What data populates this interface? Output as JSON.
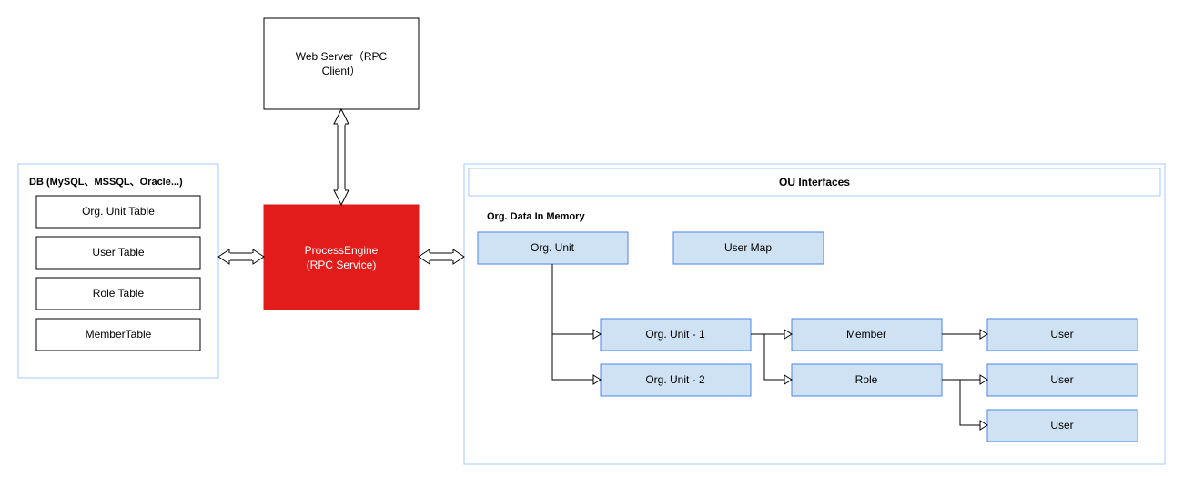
{
  "web_server": {
    "label1": "Web Server（RPC",
    "label2": "Client）"
  },
  "process_engine": {
    "label1": "ProcessEngine",
    "label2": "(RPC Service)"
  },
  "db_panel": {
    "title": "DB (MySQL、MSSQL、Oracle...)",
    "tables": [
      "Org. Unit Table",
      "User Table",
      "Role Table",
      "MemberTable"
    ]
  },
  "ou_panel": {
    "title": "OU Interfaces",
    "subtitle": "Org. Data In Memory",
    "root": "Org. Unit",
    "user_map": "User Map",
    "children": [
      "Org. Unit - 1",
      "Org. Unit - 2"
    ],
    "members": [
      "Member",
      "Role"
    ],
    "users": [
      "User",
      "User",
      "User"
    ]
  },
  "chart_data": {
    "type": "diagram",
    "nodes": [
      {
        "id": "web_server",
        "label": "Web Server (RPC Client)"
      },
      {
        "id": "process_engine",
        "label": "ProcessEngine (RPC Service)",
        "highlight": true
      },
      {
        "id": "db",
        "label": "DB (MySQL, MSSQL, Oracle...)",
        "children": [
          "Org. Unit Table",
          "User Table",
          "Role Table",
          "MemberTable"
        ]
      },
      {
        "id": "ou_interfaces",
        "label": "OU Interfaces",
        "children": [
          {
            "id": "org_data_in_memory",
            "label": "Org. Data In Memory",
            "children": [
              {
                "id": "org_unit",
                "label": "Org. Unit",
                "children": [
                  {
                    "id": "org_unit_1",
                    "label": "Org. Unit - 1",
                    "children": [
                      {
                        "id": "member",
                        "label": "Member",
                        "children": [
                          {
                            "id": "user_a",
                            "label": "User"
                          }
                        ]
                      },
                      {
                        "id": "role",
                        "label": "Role",
                        "children": [
                          {
                            "id": "user_b",
                            "label": "User"
                          },
                          {
                            "id": "user_c",
                            "label": "User"
                          }
                        ]
                      }
                    ]
                  },
                  {
                    "id": "org_unit_2",
                    "label": "Org. Unit - 2"
                  }
                ]
              },
              {
                "id": "user_map",
                "label": "User Map"
              }
            ]
          }
        ]
      }
    ],
    "edges_bidirectional": [
      [
        "web_server",
        "process_engine"
      ],
      [
        "db",
        "process_engine"
      ],
      [
        "process_engine",
        "ou_interfaces"
      ]
    ]
  }
}
